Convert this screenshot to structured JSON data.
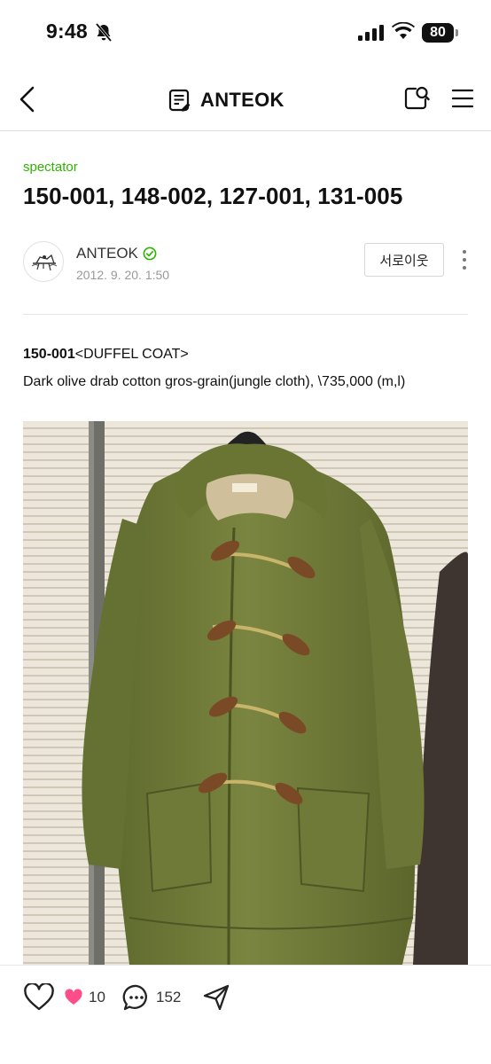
{
  "status_bar": {
    "time": "9:48",
    "battery": "80"
  },
  "nav": {
    "title": "ANTEOK"
  },
  "post": {
    "category": "spectator",
    "title": "150-001, 148-002, 127-001, 131-005",
    "author": "ANTEOK",
    "date": "2012. 9. 20. 1:50",
    "follow_label": "서로이웃",
    "body_code": "150-001",
    "body_type": "<DUFFEL COAT>",
    "body_desc": "Dark olive drab cotton gros-grain(jungle cloth), \\735,000 (m,l)"
  },
  "actions": {
    "likes": "10",
    "comments": "152"
  },
  "colors": {
    "accent_green": "#2db400",
    "heart_pink": "#ff4d8a"
  }
}
